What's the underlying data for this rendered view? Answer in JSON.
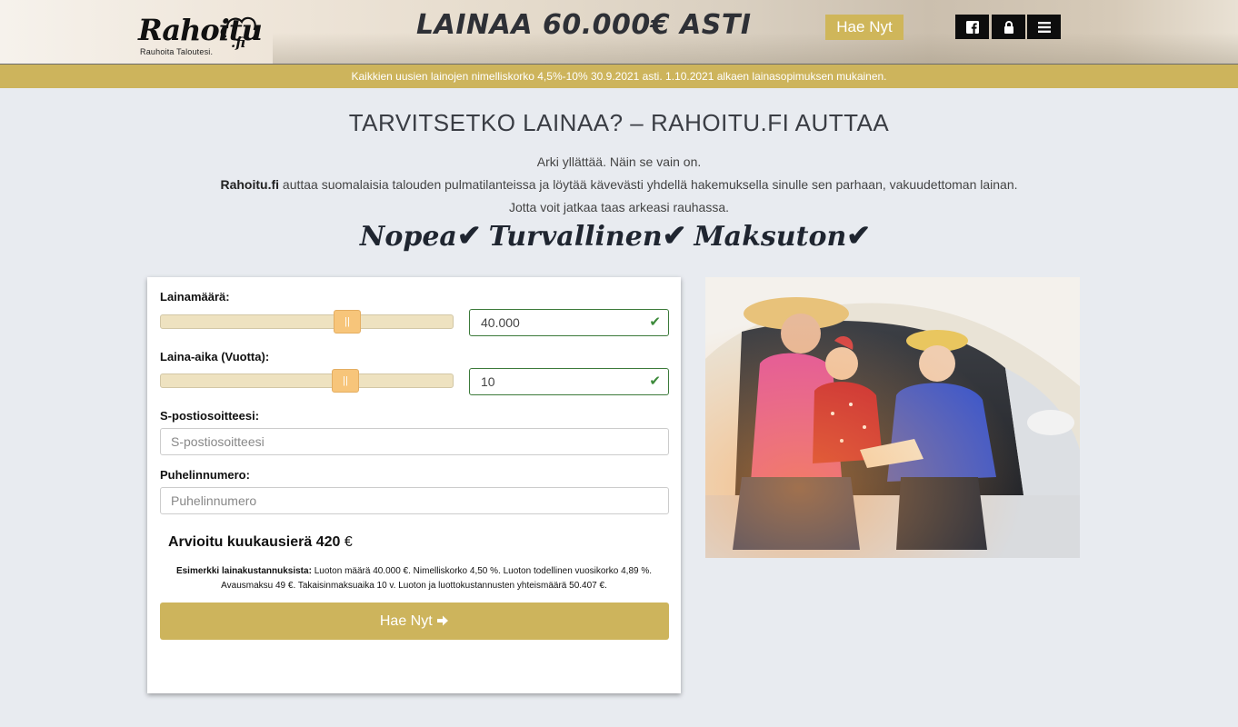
{
  "header": {
    "logo_text": "Rahoitu",
    "logo_suffix": ".fi",
    "logo_tagline": "Rauhoita Taloutesi.",
    "headline": "LAINAA 60.000€ ASTI",
    "cta_label": "Hae Nyt",
    "icons": [
      "facebook-icon",
      "lock-icon",
      "menu-icon"
    ]
  },
  "notice": "Kaikkien uusien lainojen nimelliskorko 4,5%-10% 30.9.2021 asti. 1.10.2021 alkaen lainasopimuksen mukainen.",
  "intro": {
    "title": "TARVITSETKO LAINAA? – RAHOITU.FI AUTTAA",
    "line1": "Arki yllättää. Näin se vain on.",
    "line2_brand": "Rahoitu.fi",
    "line2_rest": " auttaa suomalaisia talouden pulmatilanteissa ja löytää kävevästi yhdellä hakemuksella sinulle sen parhaan, vakuudettoman lainan.",
    "line3": "Jotta voit jatkaa taas arkeasi rauhassa.",
    "tagline": [
      "Nopea",
      "Turvallinen",
      "Maksuton"
    ]
  },
  "form": {
    "amount_label": "Lainamäärä:",
    "amount_value": "40.000",
    "amount_fraction": 0.65,
    "term_label": "Laina-aika (Vuotta):",
    "term_value": "10",
    "term_fraction": 0.64,
    "email_label": "S-postiosoitteesi:",
    "email_placeholder": "S-postiosoitteesi",
    "phone_label": "Puhelinnumero:",
    "phone_placeholder": "Puhelinnumero",
    "monthly_label": "Arvioitu kuukausierä 420",
    "monthly_currency": "€",
    "example_title": "Esimerkki lainakustannuksista:",
    "example_line1": " Luoton määrä 40.000 €. Nimelliskorko 4,50 %. Luoton todellinen vuosikorko 4,89 %.",
    "example_line2": "Avausmaksu 49 €. Takaisinmaksuaika 10 v. Luoton ja luottokustannusten yhteismäärä 50.407 €.",
    "submit_label": "Hae Nyt"
  },
  "colors": {
    "gold": "#cdb45c",
    "valid_green": "#3c8a3a",
    "slider_thumb": "#f7c57a"
  }
}
